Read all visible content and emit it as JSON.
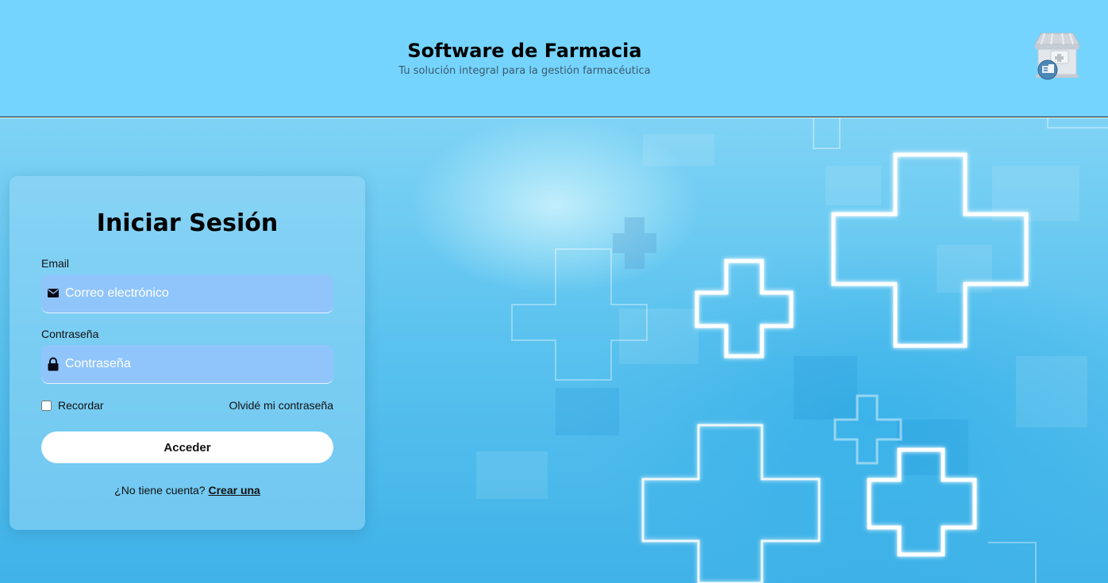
{
  "header": {
    "title": "Software de Farmacia",
    "subtitle": "Tu solución integral para la gestión farmacéutica",
    "logo_icon": "pharmacy-store-icon",
    "background_color": "#74d4fd"
  },
  "background": {
    "theme": "medical-cross-pattern",
    "colors": [
      "#7fd3f5",
      "#3fb2e8"
    ]
  },
  "login": {
    "title": "Iniciar Sesión",
    "email_label": "Email",
    "email_placeholder": "Correo electrónico",
    "email_value": "",
    "email_icon": "envelope-icon",
    "password_label": "Contraseña",
    "password_placeholder": "Contraseña",
    "password_value": "",
    "password_icon": "lock-icon",
    "remember_label": "Recordar",
    "remember_checked": false,
    "forgot_label": "Olvidé mi contraseña",
    "submit_label": "Acceder",
    "no_account_text": "¿No tiene cuenta?",
    "create_account_label": "Crear una",
    "field_color": "#90c5fb"
  }
}
